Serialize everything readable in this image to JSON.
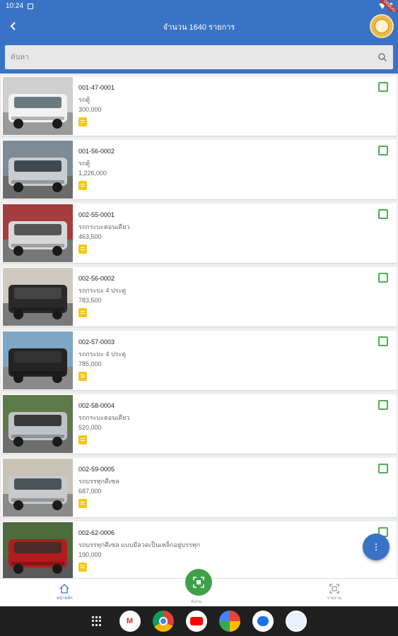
{
  "status": {
    "time": "10:24",
    "ribbon": "DEBUG"
  },
  "appbar": {
    "title": "จำนวน 1640 รายการ"
  },
  "search": {
    "placeholder": "ค้นหา"
  },
  "items": [
    {
      "code": "001-47-0001",
      "type": "รถตู้",
      "price": "300,000",
      "photo": "white-van"
    },
    {
      "code": "001-56-0002",
      "type": "รถตู้",
      "price": "1,226,000",
      "photo": "silver-van"
    },
    {
      "code": "002-55-0001",
      "type": "รถกระบะตอนเดียว",
      "price": "463,500",
      "photo": "silver-pickup-rear"
    },
    {
      "code": "002-56-0002",
      "type": "รถกระบะ 4 ประตู",
      "price": "783,500",
      "photo": "black-pickup-front"
    },
    {
      "code": "002-57-0003",
      "type": "รถกระบะ 4 ประตู",
      "price": "785,000",
      "photo": "black-pickup-rear"
    },
    {
      "code": "002-58-0004",
      "type": "รถกระบะตอนเดียว",
      "price": "520,000",
      "photo": "silver-pickup-front"
    },
    {
      "code": "002-59-0005",
      "type": "รถบรรทุกดีเซล",
      "price": "687,000",
      "photo": "silver-pickup-side"
    },
    {
      "code": "002-62-0006",
      "type": "รถบรรทุกดีเซล แบบมีลวดเป็นเหล็กอยู่บรรทุก",
      "price": "190,000",
      "photo": "red-car"
    }
  ],
  "bottomnav": {
    "home_label": "หน้าหลัก",
    "scan_label": "สแกน",
    "report_label": "รายงาน"
  },
  "colors": {
    "primary": "#3a73c5",
    "accent_green": "#4caf50",
    "note_yellow": "#f3c81c"
  }
}
